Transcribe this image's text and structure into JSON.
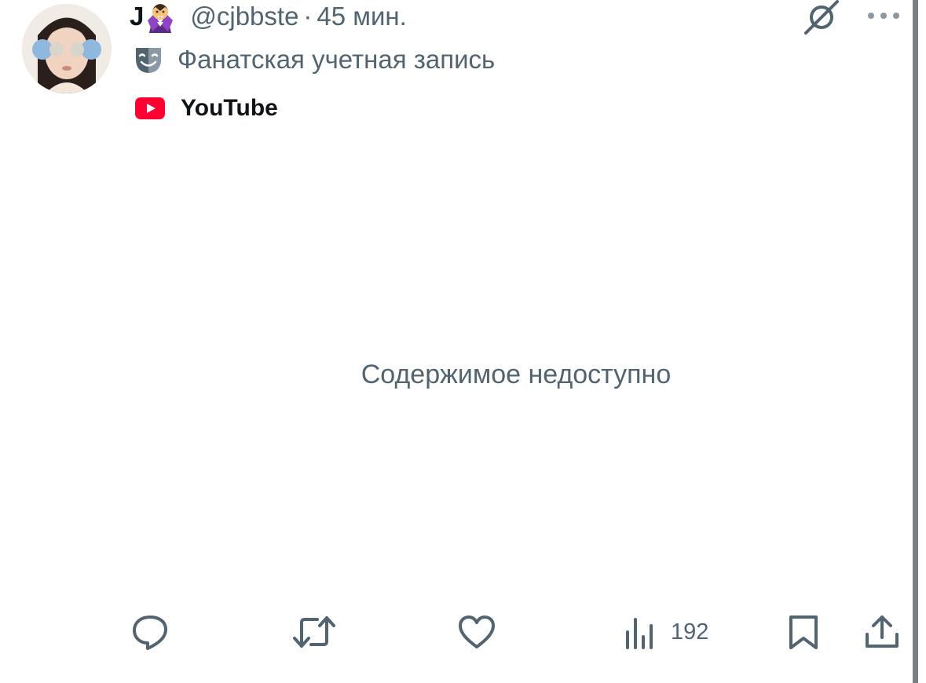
{
  "tweet": {
    "display_name": "J",
    "name_emoji": "vampire-emoji",
    "handle": "@cjbbste",
    "separator": "·",
    "time": "45 мин.",
    "account_label": "Фанатская учетная запись",
    "source": "YouTube",
    "media_status": "Содержимое недоступно"
  },
  "actions": {
    "reply_icon": "reply-icon",
    "retweet_icon": "retweet-icon",
    "like_icon": "heart-icon",
    "views_icon": "views-icon",
    "views": "192",
    "bookmark_icon": "bookmark-icon",
    "share_icon": "share-icon"
  },
  "colors": {
    "primary_text": "#0f1419",
    "secondary_text": "#536471",
    "youtube_red": "#ff0033",
    "edge_bar": "#7b7e83"
  }
}
